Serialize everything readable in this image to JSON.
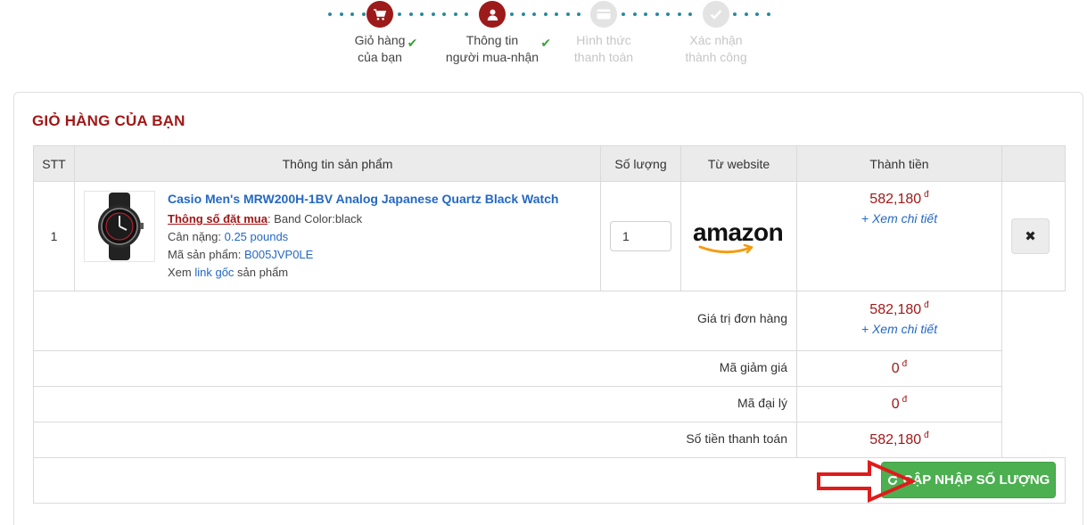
{
  "steps": [
    {
      "line1": "Giỏ hàng",
      "line2": "của bạn",
      "state": "done",
      "icon": "cart-icon"
    },
    {
      "line1": "Thông tin",
      "line2": "người mua-nhận",
      "state": "done",
      "icon": "user-icon"
    },
    {
      "line1": "Hình thức",
      "line2": "thanh toán",
      "state": "inactive",
      "icon": "card-icon"
    },
    {
      "line1": "Xác nhận",
      "line2": "thành công",
      "state": "inactive",
      "icon": "check-icon"
    }
  ],
  "step_check": "✔",
  "cart": {
    "title": "GIỎ HÀNG CỦA BẠN",
    "headers": {
      "stt": "STT",
      "info": "Thông tin sản phẩm",
      "qty": "Số lượng",
      "website": "Từ website",
      "total": "Thành tiền"
    },
    "item": {
      "stt": "1",
      "name": "Casio Men's MRW200H-1BV Analog Japanese Quartz Black Watch",
      "spec_label": "Thông số đặt mua",
      "spec_value": ": Band Color:black",
      "weight_label": "Cân nặng: ",
      "weight_value": "0.25 pounds",
      "sku_label": "Mã sản phẩm: ",
      "sku_value": "B005JVP0LE",
      "view_prefix": "Xem ",
      "view_link": "link gốc",
      "view_suffix": " sản phẩm",
      "quantity": "1",
      "website": "amazon",
      "price": "582,180",
      "currency": "đ",
      "detail_link": "+ Xem chi tiết",
      "delete_symbol": "✖"
    },
    "summary": {
      "order_value_label": "Giá trị đơn hàng",
      "order_value": "582,180",
      "order_detail_link": "+ Xem chi tiết",
      "discount_label": "Mã giảm giá",
      "discount_value": "0",
      "agent_label": "Mã đại lý",
      "agent_value": "0",
      "payment_label": "Số tiền thanh toán",
      "payment_value": "582,180",
      "currency": "đ"
    },
    "update_button": "CẬP NHẬP SỐ LƯỢNG"
  },
  "colors": {
    "brand_red": "#a21818",
    "link_blue": "#2468c4",
    "button_green": "#4caf50",
    "arrow_red": "#e01b1b",
    "step_dot": "#2a8a9e"
  }
}
